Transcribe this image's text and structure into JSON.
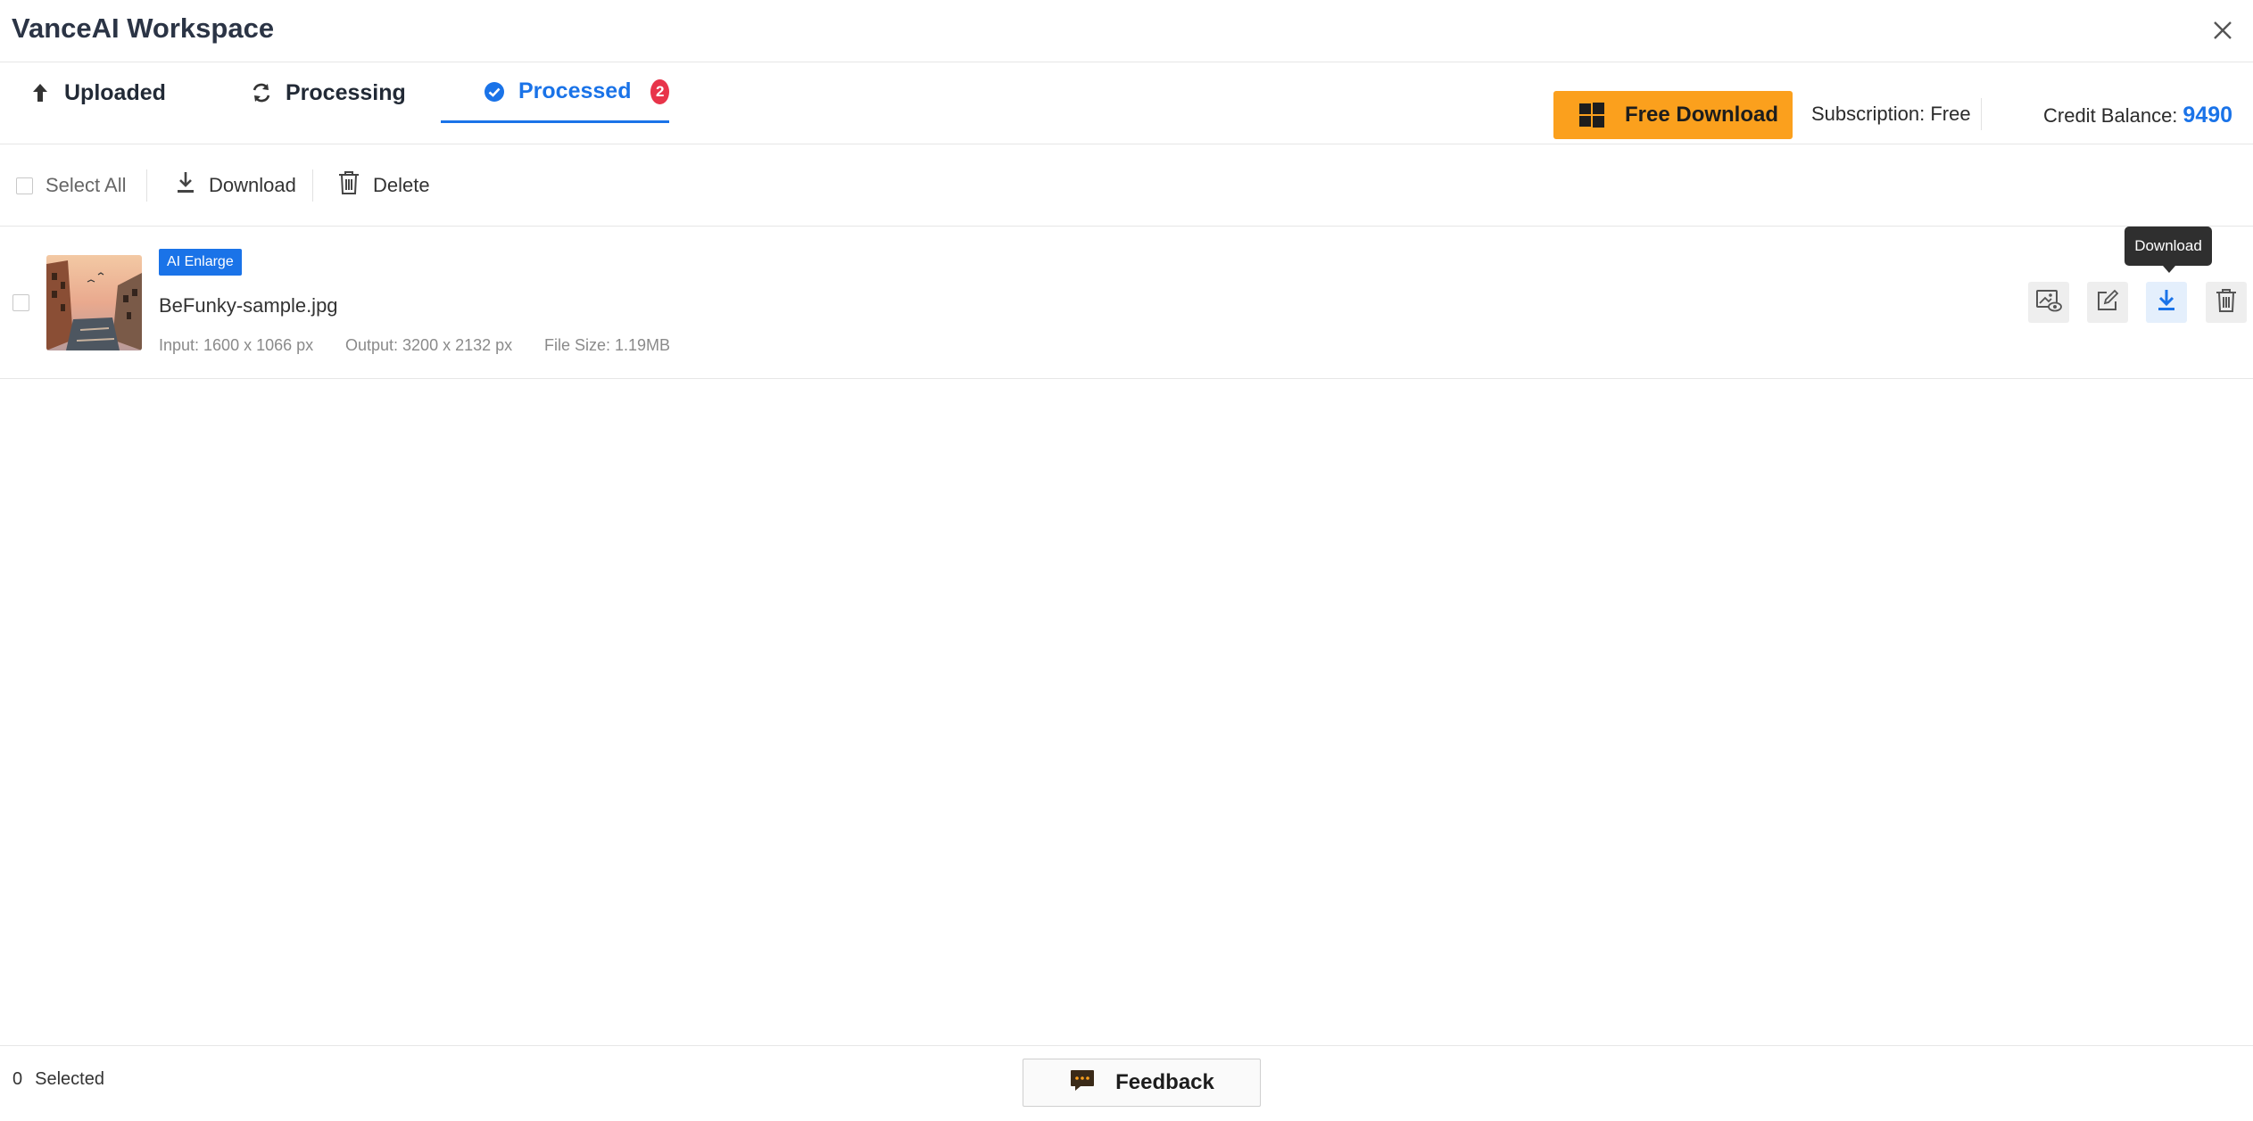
{
  "app": {
    "title": "VanceAI Workspace"
  },
  "tabs": [
    {
      "label": "Uploaded"
    },
    {
      "label": "Processing"
    },
    {
      "label": "Processed",
      "badge": "2",
      "active": true
    }
  ],
  "header": {
    "free_download_label": "Free Download",
    "subscription_label": "Subscription:",
    "subscription_value": "Free",
    "credit_label": "Credit Balance:",
    "credit_value": "9490"
  },
  "toolbar": {
    "select_all_label": "Select All",
    "download_label": "Download",
    "delete_label": "Delete"
  },
  "items": [
    {
      "tag": "AI Enlarge",
      "filename": "BeFunky-sample.jpg",
      "input": "Input: 1600 x 1066 px",
      "output": "Output: 3200 x 2132 px",
      "size": "File Size: 1.19MB"
    }
  ],
  "tooltip": {
    "label": "Download"
  },
  "footer": {
    "selected_count": "0",
    "selected_label": "Selected",
    "feedback_label": "Feedback"
  },
  "colors": {
    "accent": "#1a73e8",
    "badge": "#e8344a",
    "free_download": "#fba01d",
    "title": "#2b3445"
  }
}
